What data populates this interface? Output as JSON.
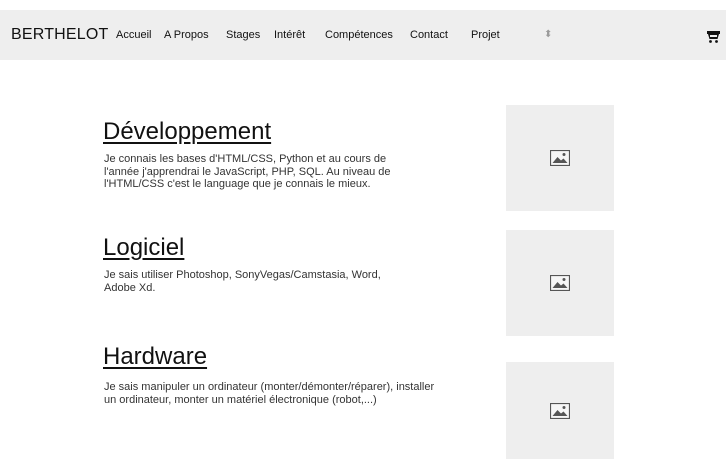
{
  "navbar": {
    "brand": "BERTHELOT",
    "links": [
      "Accueil",
      "A Propos",
      "Stages",
      "Intérêt",
      "Compétences",
      "Contact",
      "Projet"
    ],
    "sort_icon": "sort-arrows-icon",
    "cart_icon": "cart-icon"
  },
  "sections": [
    {
      "title": "Développement",
      "text": "Je connais les bases d'HTML/CSS, Python et au cours de l'année j'apprendrai le JavaScript, PHP, SQL. Au niveau de l'HTML/CSS c'est le language que je connais le mieux.",
      "image_icon": "image-placeholder-icon"
    },
    {
      "title": "Logiciel",
      "text": "Je sais utiliser Photoshop, SonyVegas/Camstasia, Word, Adobe Xd.",
      "image_icon": "image-placeholder-icon"
    },
    {
      "title": "Hardware",
      "text": "Je sais manipuler un ordinateur (monter/démonter/réparer), installer un ordinateur, monter un matériel électronique (robot,...)",
      "image_icon": "image-placeholder-icon"
    }
  ],
  "colors": {
    "navbar_bg": "#eeeeee",
    "placeholder_bg": "#eeeeee",
    "text": "#333333"
  }
}
